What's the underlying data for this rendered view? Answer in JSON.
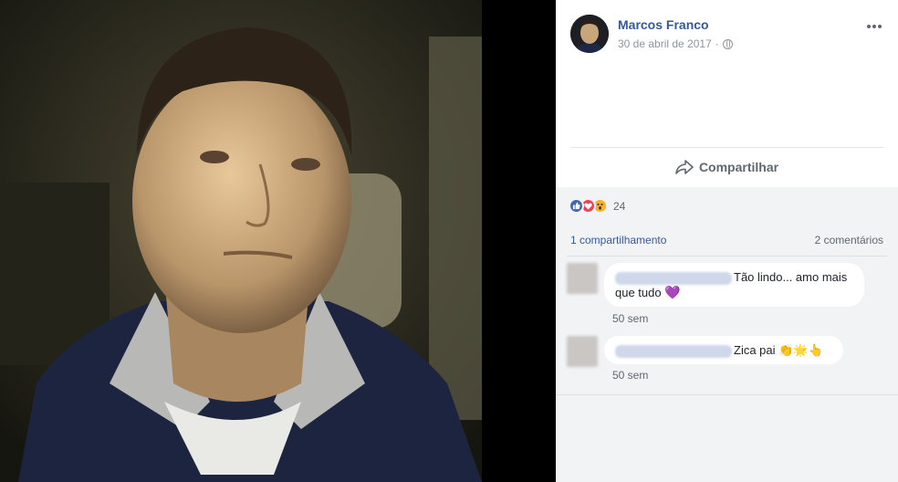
{
  "post": {
    "author": "Marcos Franco",
    "date": "30 de abril de 2017",
    "separator": "·",
    "privacy_icon": "globe-icon",
    "more_icon": "more-options-icon"
  },
  "actions": {
    "share_label": "Compartilhar",
    "share_icon": "share-arrow-icon"
  },
  "reactions": {
    "types": [
      "like",
      "love",
      "wow"
    ],
    "count": "24"
  },
  "counts": {
    "shares": "1 compartilhamento",
    "comments": "2 comentários"
  },
  "comments": [
    {
      "text": "Tão lindo... amo mais que tudo",
      "emoji": "💜",
      "time": "50 sem"
    },
    {
      "text": "Zica pai",
      "emoji": "👏🌟👆",
      "time": "50 sem"
    }
  ],
  "colors": {
    "link_blue": "#365899",
    "like_blue": "#4267b2",
    "love_red": "#f33e58",
    "wow_yellow": "#f7b125",
    "panel_gray": "#f2f3f5"
  }
}
